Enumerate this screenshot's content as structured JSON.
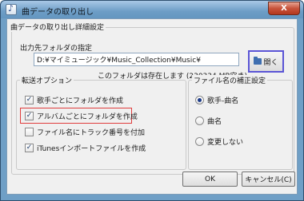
{
  "window": {
    "title": "曲データの取り出し",
    "close_label": "X"
  },
  "settings_group": {
    "label": "曲データの取り出し詳細設定"
  },
  "output_folder": {
    "label": "出力先フォルダの指定",
    "value": "D:¥マイミュージック¥Music_Collection¥Music¥",
    "status": "このフォルダは存在します (230334 MB空き)",
    "open_button_label": "開く"
  },
  "transfer_options": {
    "label": "転送オプション",
    "items": [
      {
        "label": "歌手ごとにフォルダを作成",
        "checked": true
      },
      {
        "label": "アルバムごとにフォルダを作成",
        "checked": true
      },
      {
        "label": "ファイル名にトラック番号を付加",
        "checked": false
      },
      {
        "label": "iTunesインポートファイルを作成",
        "checked": true
      }
    ]
  },
  "filename_correction": {
    "label": "ファイル名の補正設定",
    "options": [
      {
        "label": "歌手-曲名",
        "selected": true
      },
      {
        "label": "曲名",
        "selected": false
      },
      {
        "label": "変更しない",
        "selected": false
      }
    ]
  },
  "buttons": {
    "ok_label": "OK",
    "cancel_label": "キャンセル(C)"
  },
  "colors": {
    "highlight": "#e03c3c",
    "open_button_border": "#5b55d6"
  }
}
